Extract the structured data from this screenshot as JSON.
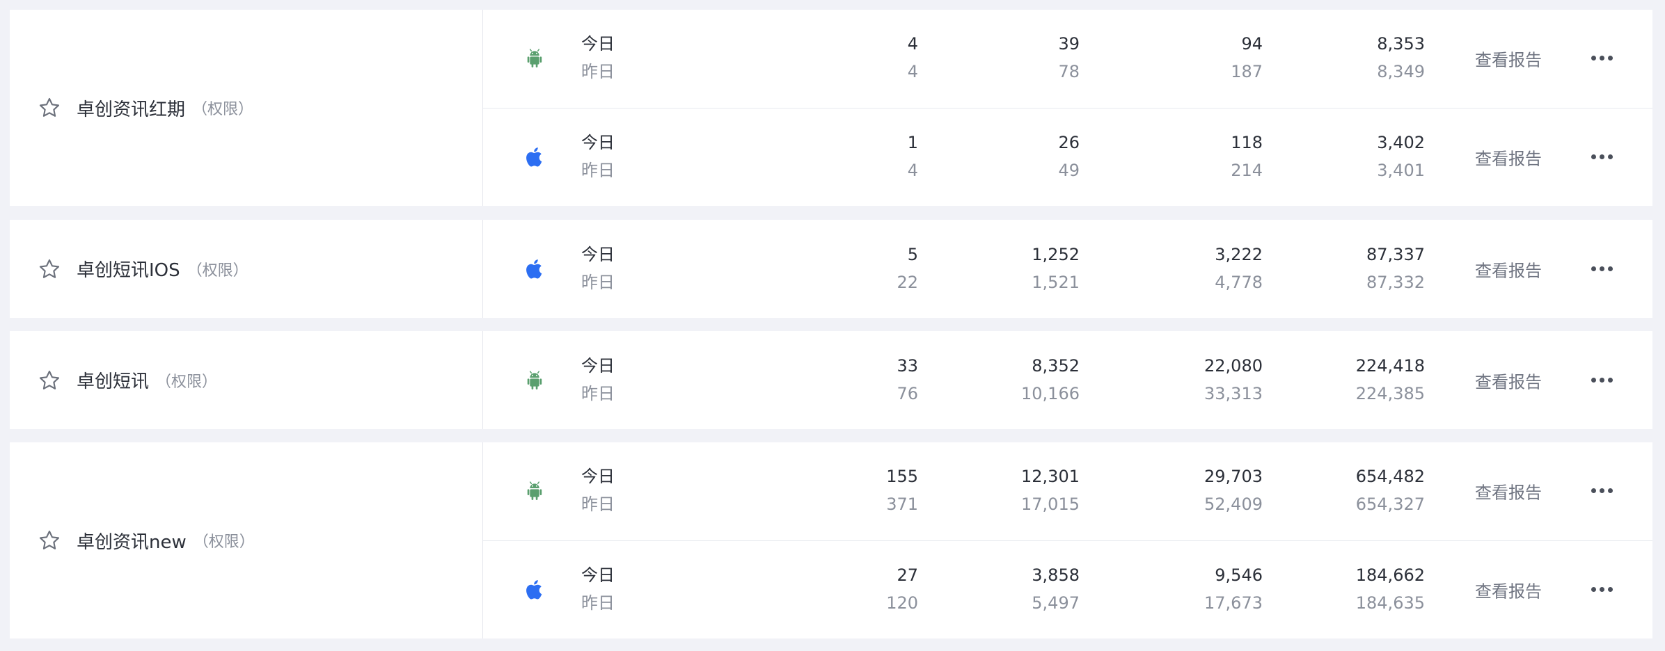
{
  "labels": {
    "today": "今日",
    "yesterday": "昨日"
  },
  "colors": {
    "android": "#5a9f6e",
    "ios": "#2c6ef2",
    "background": "#f1f2f7"
  },
  "apps": [
    {
      "name": "卓创资讯红期",
      "tag": "（权限）",
      "platforms": [
        {
          "platform": "android",
          "icon": "android-icon",
          "report_label": "查看报告",
          "today": [
            "4",
            "39",
            "94",
            "8,353"
          ],
          "yesterday": [
            "4",
            "78",
            "187",
            "8,349"
          ]
        },
        {
          "platform": "ios",
          "icon": "apple-icon",
          "report_label": "查看报告",
          "today": [
            "1",
            "26",
            "118",
            "3,402"
          ],
          "yesterday": [
            "4",
            "49",
            "214",
            "3,401"
          ]
        }
      ]
    },
    {
      "name": "卓创短讯IOS",
      "tag": "（权限）",
      "platforms": [
        {
          "platform": "ios",
          "icon": "apple-icon",
          "report_label": "查看报告",
          "today": [
            "5",
            "1,252",
            "3,222",
            "87,337"
          ],
          "yesterday": [
            "22",
            "1,521",
            "4,778",
            "87,332"
          ]
        }
      ]
    },
    {
      "name": "卓创短讯",
      "tag": "（权限）",
      "platforms": [
        {
          "platform": "android",
          "icon": "android-icon",
          "report_label": "查看报告",
          "today": [
            "33",
            "8,352",
            "22,080",
            "224,418"
          ],
          "yesterday": [
            "76",
            "10,166",
            "33,313",
            "224,385"
          ]
        }
      ]
    },
    {
      "name": "卓创资讯new",
      "tag": "（权限）",
      "platforms": [
        {
          "platform": "android",
          "icon": "android-icon",
          "report_label": "查看报告",
          "today": [
            "155",
            "12,301",
            "29,703",
            "654,482"
          ],
          "yesterday": [
            "371",
            "17,015",
            "52,409",
            "654,327"
          ]
        },
        {
          "platform": "ios",
          "icon": "apple-icon",
          "report_label": "查看报告",
          "today": [
            "27",
            "3,858",
            "9,546",
            "184,662"
          ],
          "yesterday": [
            "120",
            "5,497",
            "17,673",
            "184,635"
          ]
        }
      ]
    }
  ]
}
